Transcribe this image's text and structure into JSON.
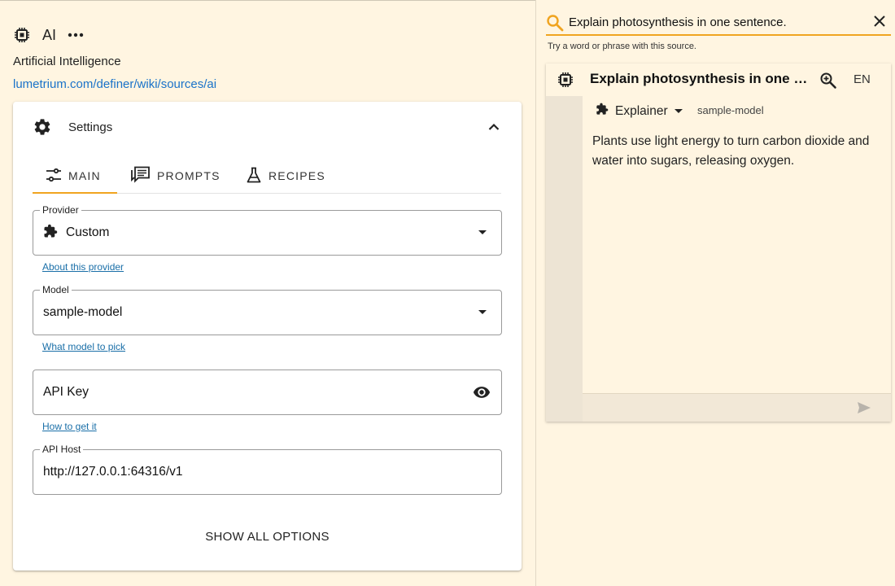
{
  "source": {
    "name": "AI",
    "description": "Artificial Intelligence",
    "link": "lumetrium.com/definer/wiki/sources/ai",
    "icons": {
      "chip": "chip-icon",
      "more": "more-horiz-icon"
    }
  },
  "settings": {
    "title": "Settings",
    "tabs": [
      {
        "label": "MAIN",
        "icon": "tune-icon",
        "active": true
      },
      {
        "label": "PROMPTS",
        "icon": "chat-icon",
        "active": false
      },
      {
        "label": "RECIPES",
        "icon": "flask-icon",
        "active": false
      }
    ],
    "provider": {
      "label": "Provider",
      "value": "Custom",
      "help": "About this provider"
    },
    "model": {
      "label": "Model",
      "value": "sample-model",
      "help": "What model to pick"
    },
    "api_key": {
      "placeholder": "API Key",
      "help": "How to get it"
    },
    "api_host": {
      "label": "API Host",
      "value": "http://127.0.0.1:64316/v1"
    },
    "show_all": "SHOW ALL OPTIONS"
  },
  "search": {
    "query": "Explain photosynthesis in one sentence.",
    "hint": "Try a word or phrase with this source."
  },
  "result": {
    "title": "Explain photosynthesis in one sentence.",
    "language": "EN",
    "recipe": "Explainer",
    "model": "sample-model",
    "answer": "Plants use light energy to turn carbon dioxide and water into sugars, releasing oxygen."
  },
  "colors": {
    "accent": "#f0a420",
    "background": "#fff5e1",
    "link": "#1a73c9",
    "card": "#ffffff"
  }
}
